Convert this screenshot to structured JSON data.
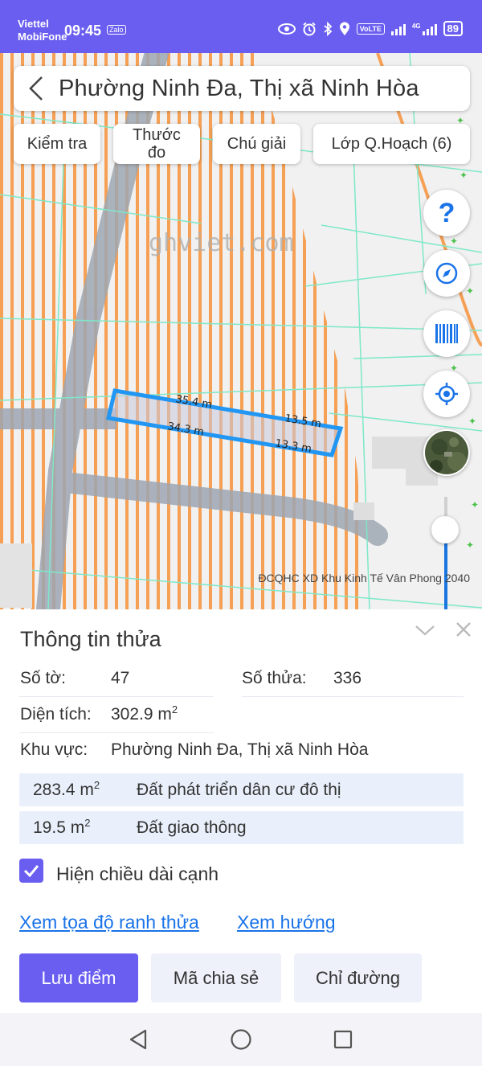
{
  "status_bar": {
    "carrier1": "Viettel",
    "carrier2": "MobiFone",
    "time": "09:45",
    "zalo": "Zalo",
    "volte": "VoLTE",
    "network": "4G",
    "battery": "89"
  },
  "header": {
    "title": "Phường Ninh Đa, Thị xã Ninh Hòa"
  },
  "toolbar": {
    "check": "Kiểm tra",
    "ruler_line1": "Thước",
    "ruler_line2": "đo",
    "legend": "Chú giải",
    "layers": "Lớp Q.Hoạch (6)"
  },
  "map": {
    "watermark": "ghviet.com",
    "edge_top": "35.4 m",
    "edge_bottom": "34.3 m",
    "edge_right_top": "13.5 m",
    "edge_right_bottom": "13.3 m",
    "caption": "ĐCQHC XD Khu Kinh Tế Vân Phong 2040",
    "help_glyph": "?",
    "colors": {
      "planning_stripe": "#f5a055",
      "road": "#9ea7b3",
      "parcel_outline": "#2196f3",
      "boundary": "#7ee8c9"
    },
    "opacity_slider": 0.7
  },
  "panel": {
    "title": "Thông tin thửa",
    "sheet_label": "Số tờ:",
    "sheet_value": "47",
    "parcel_label": "Số thửa:",
    "parcel_value": "336",
    "area_label": "Diện tích:",
    "area_value": "302.9 m",
    "area_unit_sup": "2",
    "region_label": "Khu vực:",
    "region_value": "Phường Ninh Đa, Thị xã Ninh Hòa",
    "land_uses": [
      {
        "area": "283.4 m",
        "sup": "2",
        "type": "Đất phát triển dân cư đô thị"
      },
      {
        "area": "19.5 m",
        "sup": "2",
        "type": "Đất giao thông"
      }
    ],
    "show_edges_label": "Hiện chiều dài cạnh",
    "show_edges_checked": true,
    "link_coords": "Xem tọa độ ranh thửa",
    "link_direction": "Xem hướng",
    "btn_save": "Lưu điểm",
    "btn_share": "Mã chia sẻ",
    "btn_directions": "Chỉ đường"
  },
  "accent_color": "#6a5ef0",
  "link_color": "#1a73e8"
}
